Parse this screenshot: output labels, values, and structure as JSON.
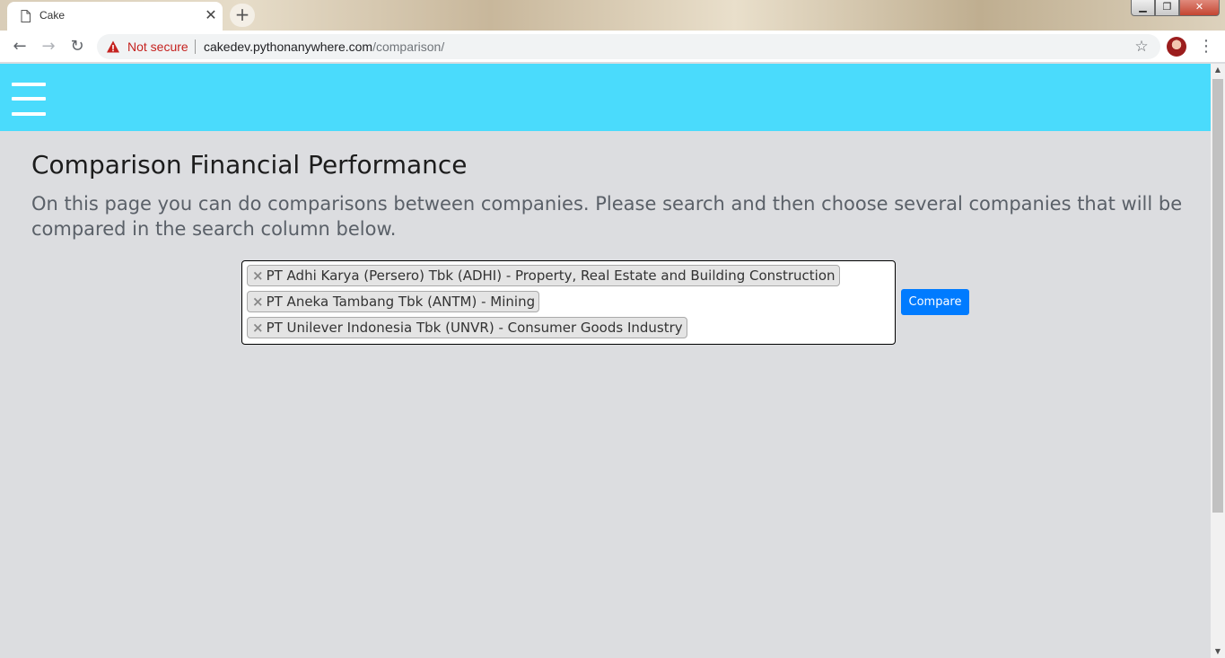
{
  "browser": {
    "tab": {
      "title": "Cake",
      "icon": "page-icon"
    },
    "new_tab_label": "+",
    "window_controls": {
      "minimize": "▁",
      "restore": "❐",
      "close": "✕"
    },
    "nav": {
      "back": "←",
      "forward": "→",
      "reload": "↻"
    },
    "omnibox": {
      "security_label": "Not secure",
      "url_host": "cakedev.pythonanywhere.com",
      "url_path": "/comparison/"
    },
    "star_glyph": "☆",
    "menu_glyph": "⋮"
  },
  "header": {
    "bg_color": "#4adbfc",
    "menu_icon": "hamburger-icon"
  },
  "page": {
    "title": "Comparison Financial Performance",
    "lead": "On this page you can do comparisons between companies. Please search and then choose several companies that will be compared in the search column below.",
    "selected_companies": [
      "PT Adhi Karya (Persero) Tbk (ADHI) - Property, Real Estate and Building Construction",
      "PT Aneka Tambang Tbk (ANTM) - Mining",
      "PT Unilever Indonesia Tbk (UNVR) - Consumer Goods Industry"
    ],
    "chip_remove_glyph": "×",
    "compare_label": "Compare",
    "compare_color": "#007bff"
  }
}
